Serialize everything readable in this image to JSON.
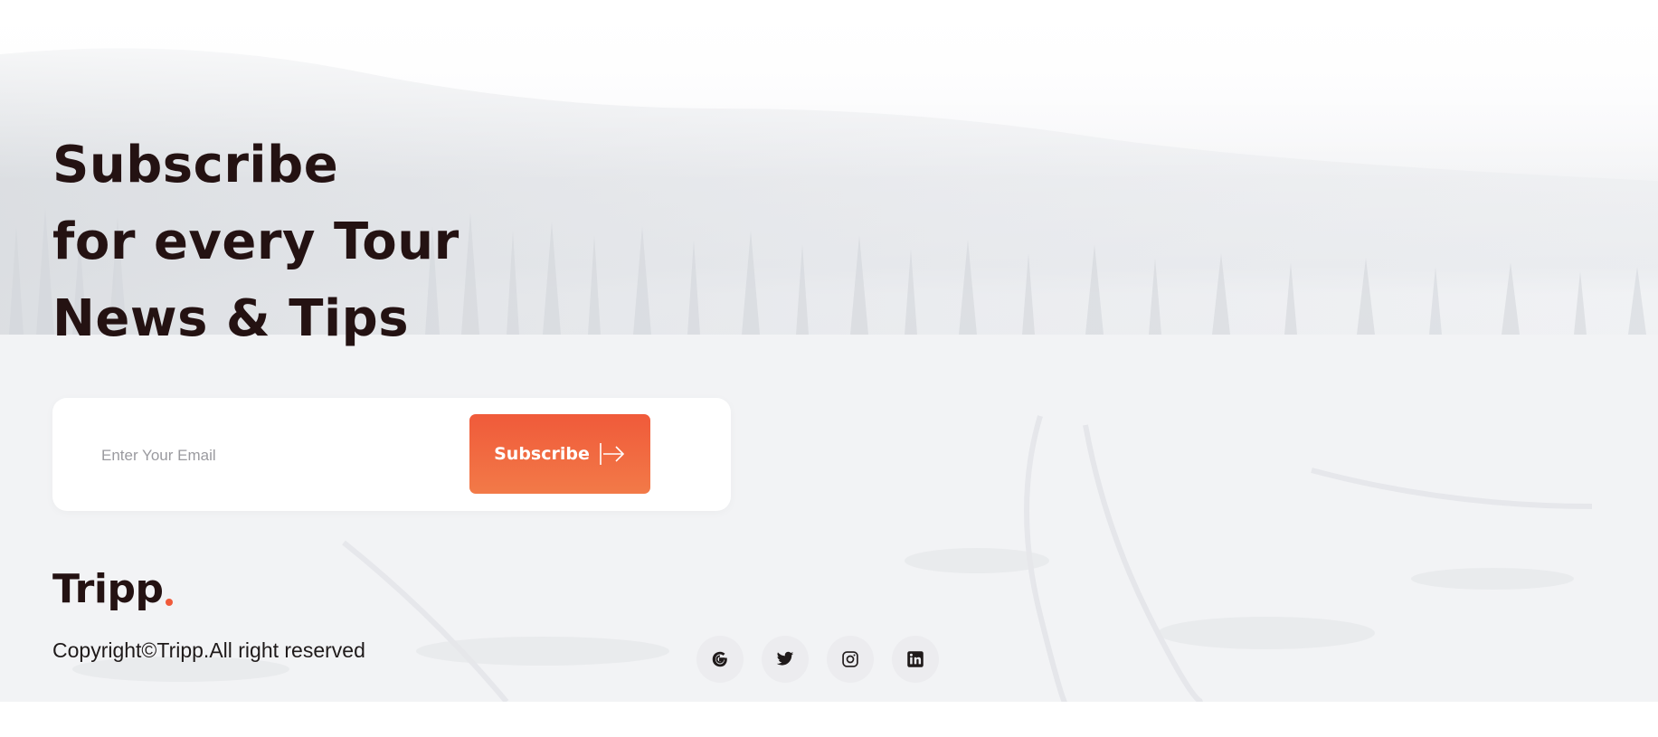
{
  "headline": {
    "line1": "Subscribe",
    "line2": "for every Tour",
    "line3": "News & Tips"
  },
  "subscribe": {
    "email_placeholder": "Enter Your Email",
    "email_value": "",
    "button_label": "Subscribe",
    "button_icon": "arrow-right-icon"
  },
  "footer": {
    "logo_text": "Tripp",
    "copyright": "Copyright©Tripp.All right reserved",
    "socials": [
      {
        "name": "google",
        "icon": "google-icon"
      },
      {
        "name": "twitter",
        "icon": "twitter-icon"
      },
      {
        "name": "instagram",
        "icon": "instagram-icon"
      },
      {
        "name": "linkedin",
        "icon": "linkedin-icon"
      }
    ]
  },
  "colors": {
    "accent": "#f05a3a",
    "accent_light": "#f27a48",
    "heading": "#241212",
    "social_bg": "#ececef"
  }
}
